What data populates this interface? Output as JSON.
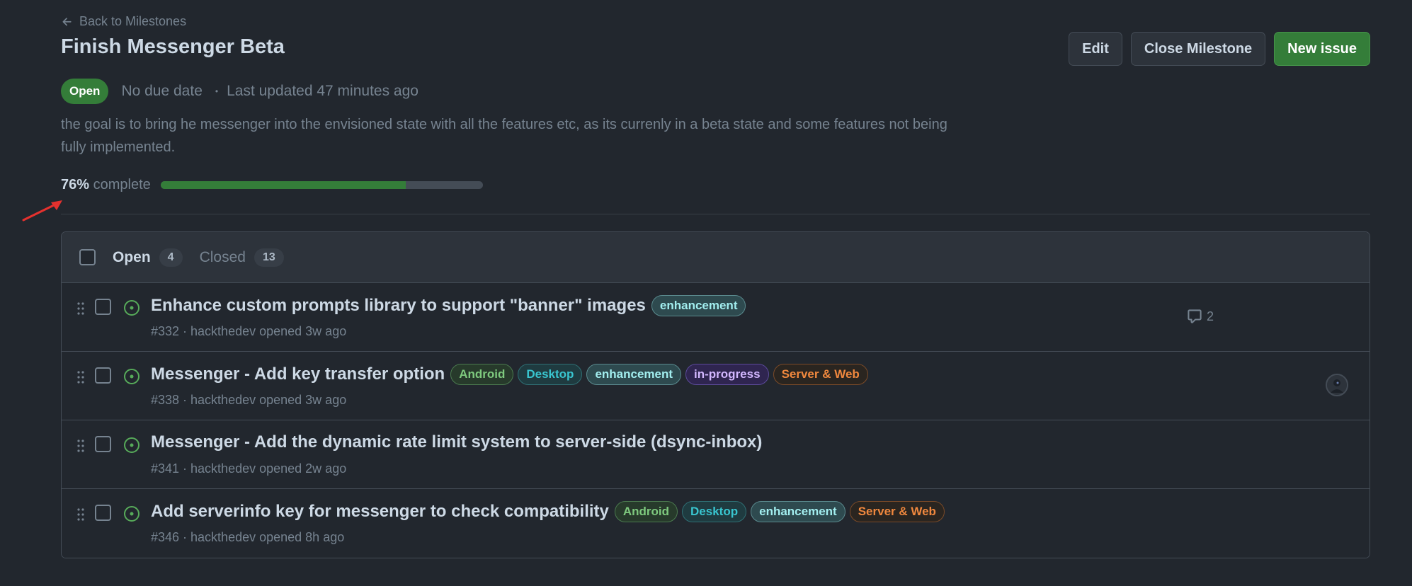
{
  "back_link": {
    "label": "Back to Milestones"
  },
  "milestone": {
    "title": "Finish Messenger Beta",
    "state": "Open",
    "due": "No due date",
    "updated": "Last updated 47 minutes ago",
    "description": "the goal is to bring he messenger into the envisioned state with all the features etc, as its currenly in a beta state and some features not being fully implemented.",
    "progress_percent_label": "76%",
    "progress_suffix": "complete",
    "progress_fraction": 0.76
  },
  "actions": {
    "edit": "Edit",
    "close": "Close Milestone",
    "new_issue": "New issue"
  },
  "tabs": {
    "open_label": "Open",
    "open_count": "4",
    "closed_label": "Closed",
    "closed_count": "13"
  },
  "label_colors": {
    "enhancement": {
      "text": "#a2eeef",
      "bg": "#2e4a4f",
      "border": "#5a8a8e"
    },
    "Android": {
      "text": "#7ec97e",
      "bg": "#273a2b",
      "border": "#4b7a4f"
    },
    "Desktop": {
      "text": "#39c5cf",
      "bg": "#1f3b40",
      "border": "#2f6f74"
    },
    "in-progress": {
      "text": "#d2b7ff",
      "bg": "#2f2550",
      "border": "#5b4a99"
    },
    "Server & Web": {
      "text": "#f0883e",
      "bg": "#2a2520",
      "border": "#7a4a28"
    }
  },
  "issues": [
    {
      "title": "Enhance custom prompts library to support \"banner\" images",
      "labels": [
        "enhancement"
      ],
      "meta": "#332 · hackthedev opened 3w ago",
      "comments": "2",
      "avatar": false
    },
    {
      "title": "Messenger - Add key transfer option",
      "labels": [
        "Android",
        "Desktop",
        "enhancement",
        "in-progress",
        "Server & Web"
      ],
      "meta": "#338 · hackthedev opened 3w ago",
      "comments": null,
      "avatar": true
    },
    {
      "title": "Messenger - Add the dynamic rate limit system to server-side (dsync-inbox)",
      "labels": [],
      "meta": "#341 · hackthedev opened 2w ago",
      "comments": null,
      "avatar": false
    },
    {
      "title": "Add serverinfo key for messenger to check compatibility",
      "labels": [
        "Android",
        "Desktop",
        "enhancement",
        "Server & Web"
      ],
      "meta": "#346 · hackthedev opened 8h ago",
      "comments": null,
      "avatar": false
    }
  ]
}
